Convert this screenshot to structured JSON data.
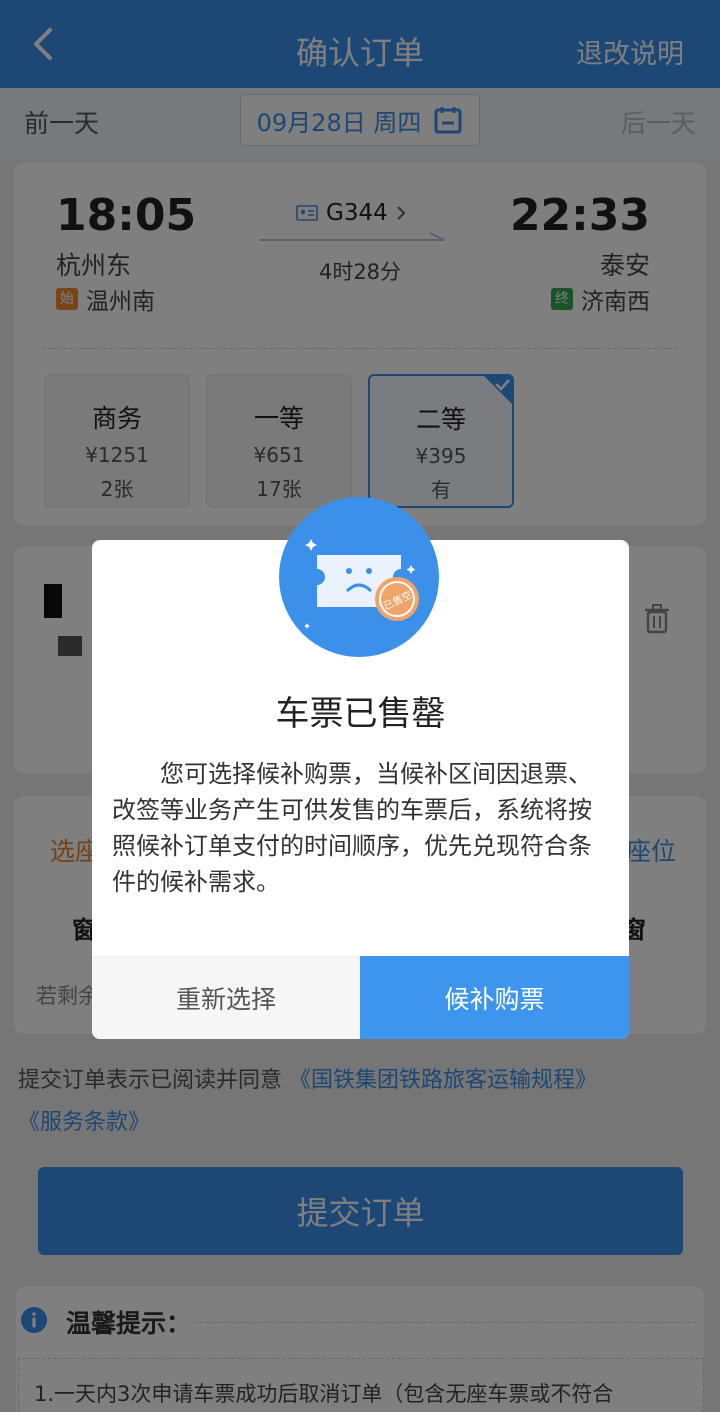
{
  "header": {
    "title": "确认订单",
    "right_link": "退改说明",
    "back_icon": "chevron-left-icon"
  },
  "date_bar": {
    "prev": "前一天",
    "date": "09月28日 周四",
    "next": "后一天"
  },
  "train": {
    "departure_time": "18:05",
    "arrival_time": "22:33",
    "departure_station": "杭州东",
    "arrival_station": "泰安",
    "origin_tag": "始",
    "origin_station": "温州南",
    "terminus_tag": "终",
    "terminus_station": "济南西",
    "train_number": "G344",
    "duration": "4时28分"
  },
  "seats": [
    {
      "name": "商务",
      "price": "¥1251",
      "availability": "2张",
      "selected": false
    },
    {
      "name": "一等",
      "price": "¥651",
      "availability": "17张",
      "selected": false
    },
    {
      "name": "二等",
      "price": "¥395",
      "availability": "有",
      "selected": true
    }
  ],
  "seat_pick": {
    "left_label": "选座",
    "right_label": "座位",
    "left_window": "窗",
    "right_window": "窗",
    "remain_text": "若剩余"
  },
  "agreement": {
    "prefix": "提交订单表示已阅读并同意 ",
    "link1": "《国铁集团铁路旅客运输规程》",
    "link2": "《服务条款》"
  },
  "submit": {
    "label": "提交订单"
  },
  "tips": {
    "title": "温馨提示：",
    "line1": "1.一天内3次申请车票成功后取消订单（包含无座车票或不符合"
  },
  "modal": {
    "title": "车票已售罄",
    "body": "您可选择候补购票，当候补区间因退票、改签等业务产生可供发售的车票后，系统将按照候补订单支付的时间顺序，优先兑现符合条件的候补需求。",
    "cancel_label": "重新选择",
    "confirm_label": "候补购票",
    "stamp_text": "已售空"
  },
  "colors": {
    "primary": "#3b91ea",
    "orange": "#ef8b2d",
    "green": "#35a454"
  }
}
